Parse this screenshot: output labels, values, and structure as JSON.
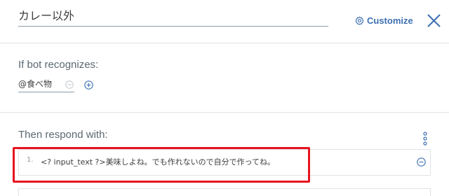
{
  "header": {
    "node_name": "カレー以外",
    "customize_label": "Customize"
  },
  "recognize": {
    "label": "If bot recognizes:",
    "conditions": [
      {
        "value": "@食べ物"
      }
    ]
  },
  "respond": {
    "label": "Then respond with:",
    "responses": [
      {
        "number": "1.",
        "text": "<? input_text ?>美味しよね。でも作れないので自分で作ってね。"
      }
    ]
  },
  "colors": {
    "accent": "#3d70b2",
    "highlight": "#e8141e",
    "divider": "#dfe3e6"
  },
  "icons": {
    "customize": "gear-icon",
    "close": "close-icon",
    "remove": "minus-circle-icon",
    "add": "plus-circle-icon",
    "menu": "kebab-menu-icon"
  }
}
